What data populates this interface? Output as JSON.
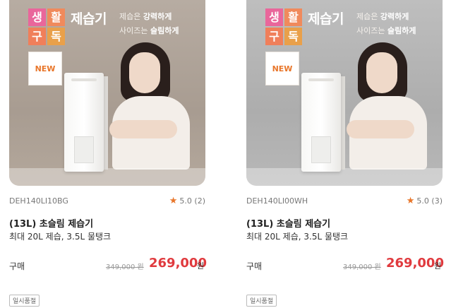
{
  "products": [
    {
      "logo_chars": [
        "생",
        "활",
        "구",
        "독"
      ],
      "hero_title": "제습기",
      "hero_copy_1a": "제습은 ",
      "hero_copy_1b": "강력하게",
      "hero_copy_2a": "사이즈는 ",
      "hero_copy_2b": "슬림하게",
      "badge": "NEW",
      "model": "DEH140LI10BG",
      "rating": "5.0 (2)",
      "name": "(13L) 초슬림 제습기",
      "spec": "최대 20L 제습, 3.5L 물탱크",
      "buy_label": "구매",
      "original_price": "349,000 원",
      "price": "269,000",
      "currency": "원",
      "status": "일시품절"
    },
    {
      "logo_chars": [
        "생",
        "활",
        "구",
        "독"
      ],
      "hero_title": "제습기",
      "hero_copy_1a": "제습은 ",
      "hero_copy_1b": "강력하게",
      "hero_copy_2a": "사이즈는 ",
      "hero_copy_2b": "슬림하게",
      "badge": "NEW",
      "model": "DEH140LI00WH",
      "rating": "5.0 (3)",
      "name": "(13L) 초슬림 제습기",
      "spec": "최대 20L 제습, 3.5L 물탱크",
      "buy_label": "구매",
      "original_price": "349,000 원",
      "price": "269,000",
      "currency": "원",
      "status": "일시품절"
    }
  ],
  "colors": {
    "accent_orange": "#e8762a",
    "price_red": "#e03a3e"
  },
  "icons": {
    "rating": "star-icon"
  }
}
